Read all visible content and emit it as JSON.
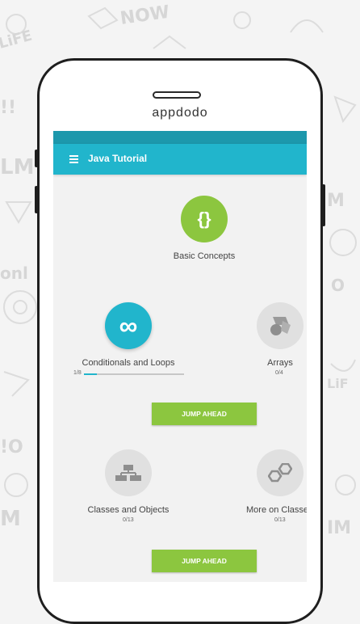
{
  "device": {
    "brand": "appdodo"
  },
  "app": {
    "title": "Java Tutorial",
    "accent": "#21b5cc",
    "green": "#8cc63f"
  },
  "topics": [
    {
      "label": "Basic Concepts",
      "icon": "curly-braces-icon",
      "glyph": "{}",
      "state": "completed"
    },
    {
      "label": "Conditionals and Loops",
      "icon": "infinity-icon",
      "glyph": "∞",
      "state": "in-progress",
      "count": "1/8",
      "progress": 0.125
    },
    {
      "label": "Arrays",
      "icon": "shapes-icon",
      "state": "locked",
      "count": "0/4"
    },
    {
      "label": "Classes and Objects",
      "icon": "hierarchy-icon",
      "state": "locked",
      "count": "0/13"
    },
    {
      "label": "More on Classes",
      "icon": "hexagons-icon",
      "state": "locked",
      "count": "0/13"
    }
  ],
  "buttons": {
    "jump_ahead": "JUMP AHEAD"
  }
}
